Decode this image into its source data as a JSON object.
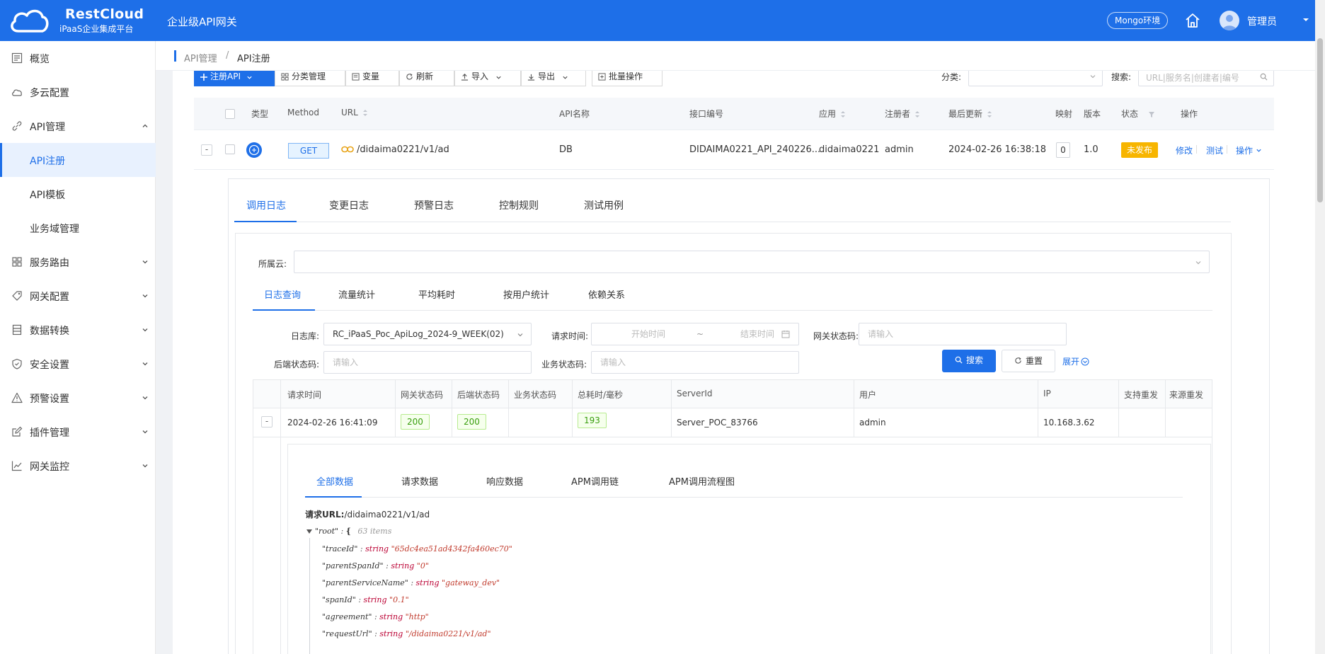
{
  "header": {
    "brand": "RestCloud",
    "brand_sub": "iPaaS企业集成平台",
    "product": "企业级API网关",
    "env": "Mongo环境",
    "user": "管理员"
  },
  "sidebar": {
    "items": [
      {
        "label": "概览",
        "icon": "overview-icon"
      },
      {
        "label": "多云配置",
        "icon": "cloud-icon"
      },
      {
        "label": "API管理",
        "icon": "link-icon"
      },
      {
        "label": "API注册"
      },
      {
        "label": "API模板"
      },
      {
        "label": "业务域管理"
      },
      {
        "label": "服务路由",
        "icon": "grid-icon"
      },
      {
        "label": "网关配置",
        "icon": "tag-icon"
      },
      {
        "label": "数据转换",
        "icon": "database-icon"
      },
      {
        "label": "安全设置",
        "icon": "shield-icon"
      },
      {
        "label": "预警设置",
        "icon": "warning-icon"
      },
      {
        "label": "插件管理",
        "icon": "edit-icon"
      },
      {
        "label": "网关监控",
        "icon": "chart-icon"
      }
    ]
  },
  "breadcrumb": {
    "root": "API管理",
    "sep": "/",
    "current": "API注册"
  },
  "toolbar": {
    "register": "注册API",
    "category": "分类管理",
    "variable": "变量",
    "refresh": "刷新",
    "import": "导入",
    "export": "导出",
    "batch": "批量操作",
    "category_label": "分类:",
    "search_label": "搜索:",
    "search_placeholder": "URL|服务名|创建者|编号"
  },
  "api_table": {
    "headers": [
      "类型",
      "Method",
      "URL",
      "API名称",
      "接口编号",
      "应用",
      "注册者",
      "最后更新",
      "映射",
      "版本",
      "状态",
      "操作"
    ],
    "row": {
      "expand": "-",
      "method": "GET",
      "url": "/didaima0221/v1/ad",
      "name": "DB",
      "code": "DIDAIMA0221_API_240226...",
      "app": "didaima0221",
      "registrant": "admin",
      "updated": "2024-02-26 16:38:18",
      "mapping": "0",
      "version": "1.0",
      "status": "未发布",
      "action_edit": "修改",
      "action_test": "测试",
      "action_more": "操作"
    }
  },
  "detail_tabs": [
    "调用日志",
    "变更日志",
    "预警日志",
    "控制规则",
    "测试用例"
  ],
  "cloud": {
    "label": "所属云:",
    "value": ""
  },
  "log_tabs": [
    "日志查询",
    "流量统计",
    "平均耗时",
    "按用户统计",
    "依赖关系"
  ],
  "filters": {
    "logdb_label": "日志库:",
    "logdb_value": "RC_iPaaS_Poc_ApiLog_2024-9_WEEK(02)",
    "time_label": "请求时间:",
    "time_start": "开始时间",
    "time_sep": "~",
    "time_end": "结束时间",
    "gw_code_label": "网关状态码:",
    "gw_code_placeholder": "请输入",
    "be_code_label": "后端状态码:",
    "be_code_placeholder": "请输入",
    "biz_code_label": "业务状态码:",
    "biz_code_placeholder": "请输入",
    "search": "搜索",
    "reset": "重置",
    "expand": "展开"
  },
  "log_table": {
    "headers": [
      "请求时间",
      "网关状态码",
      "后端状态码",
      "业务状态码",
      "总耗时/毫秒",
      "ServerId",
      "用户",
      "IP",
      "支持重发",
      "来源重发"
    ],
    "row": {
      "expand": "-",
      "time": "2024-02-26 16:41:09",
      "gw_code": "200",
      "be_code": "200",
      "biz_code": "",
      "duration": "193",
      "server": "Server_POC_83766",
      "user": "admin",
      "ip": "10.168.3.62"
    }
  },
  "viewer": {
    "tabs": [
      "全部数据",
      "请求数据",
      "响应数据",
      "APM调用链",
      "APM调用流程图"
    ],
    "url_label": "请求URL:",
    "url_value": "/didaima0221/v1/ad",
    "root_key": "\"root\"",
    "root_count": "63 items",
    "lines": [
      {
        "key": "\"traceId\"",
        "type": "string",
        "value": "\"65dc4ea51ad4342fa460ec70\""
      },
      {
        "key": "\"parentSpanId\"",
        "type": "string",
        "value": "\"0\""
      },
      {
        "key": "\"parentServiceName\"",
        "type": "string",
        "value": "\"gateway_dev\""
      },
      {
        "key": "\"spanId\"",
        "type": "string",
        "value": "\"0.1\""
      },
      {
        "key": "\"agreement\"",
        "type": "string",
        "value": "\"http\""
      },
      {
        "key": "\"requestUrl\"",
        "type": "string",
        "value": "\"/didaima0221/v1/ad\""
      }
    ]
  },
  "colors": {
    "primary": "#1e6fe8",
    "status_unpublished": "#f7b500",
    "success_tag": "#389e0d"
  }
}
